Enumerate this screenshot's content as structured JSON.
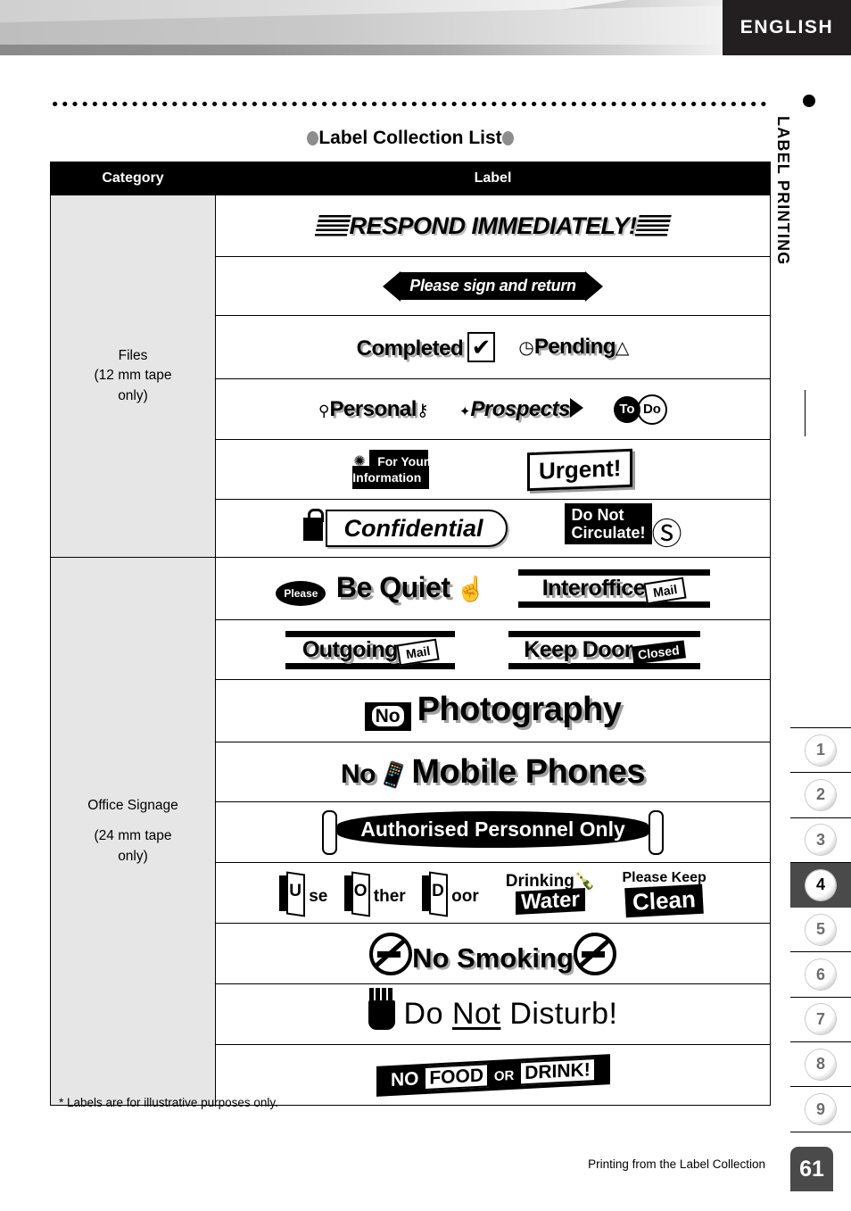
{
  "header": {
    "language_badge": "ENGLISH"
  },
  "side_tab": {
    "bullet": "bullet-dot",
    "title": "LABEL PRINTING"
  },
  "page_title": "Label Collection List",
  "table": {
    "columns": [
      "Category",
      "Label"
    ],
    "groups": [
      {
        "category": "Files\n(12 mm tape\nonly)",
        "category_name": "Files",
        "category_note": "(12 mm tape only)",
        "rows": [
          {
            "labels": [
              "RESPOND IMMEDIATELY!"
            ]
          },
          {
            "labels": [
              "Please sign and return"
            ]
          },
          {
            "labels": [
              "Completed",
              "Pending"
            ]
          },
          {
            "labels": [
              "Personal",
              "Prospects",
              "To Do"
            ]
          },
          {
            "labels": [
              "For Your Information",
              "Urgent!"
            ]
          },
          {
            "labels": [
              "Confidential",
              "Do Not Circulate!"
            ]
          }
        ]
      },
      {
        "category": "Office Signage\n(24 mm tape\nonly)",
        "category_name": "Office Signage",
        "category_note": "(24 mm tape only)",
        "rows": [
          {
            "labels": [
              "Please Be Quiet",
              "Interoffice Mail"
            ]
          },
          {
            "labels": [
              "Outgoing Mail",
              "Keep Door Closed"
            ]
          },
          {
            "labels": [
              "No Photography"
            ]
          },
          {
            "labels": [
              "No Mobile Phones"
            ]
          },
          {
            "labels": [
              "Authorised Personnel Only"
            ]
          },
          {
            "labels": [
              "Use Other Door",
              "Drinking Water",
              "Please Keep Clean"
            ]
          },
          {
            "labels": [
              "No Smoking"
            ]
          },
          {
            "labels": [
              "Do Not Disturb!"
            ]
          },
          {
            "labels": [
              "NO FOOD OR DRINK!"
            ]
          }
        ]
      }
    ]
  },
  "labels": {
    "respond": "RESPOND IMMEDIATELY!",
    "please_sign": "Please sign and return",
    "completed": "Completed",
    "pending": "Pending",
    "personal": "Personal",
    "prospects": "Prospects",
    "todo_to": "To",
    "todo_do": "Do",
    "fyi_line1": "For Your",
    "fyi_line2": "Information",
    "urgent": "Urgent!",
    "confidential": "Confidential",
    "donot_line1": "Do Not",
    "donot_line2": "Circulate!",
    "please": "Please",
    "be_quiet": "Be Quiet",
    "interoffice": "Interoffice",
    "mail": "Mail",
    "outgoing": "Outgoing",
    "outgoing_mail": "Mail",
    "keep_door": "Keep Door",
    "closed": "Closed",
    "no_small": "No",
    "photography": "Photography",
    "mobile_phones": "Mobile Phones",
    "authorised": "Authorised Personnel Only",
    "use_u": "U",
    "use_rest": "se",
    "other_o": "O",
    "other_rest": "ther",
    "door_d": "D",
    "door_rest": "oor",
    "drinking": "Drinking",
    "water": "Water",
    "please_keep": "Please Keep",
    "clean": "Clean",
    "no_smoking": "No Smoking",
    "do": "Do",
    "not": "Not",
    "disturb": "Disturb!",
    "nofood_no": "NO",
    "nofood_food": "FOOD",
    "nofood_or": "OR",
    "nofood_drink": "DRINK!"
  },
  "footnote": "* Labels are for illustrative purposes only.",
  "footer": {
    "section_title": "Printing from the Label Collection",
    "page_number": "61"
  },
  "side_tabs": [
    {
      "number": "1",
      "active": false
    },
    {
      "number": "2",
      "active": false
    },
    {
      "number": "3",
      "active": false
    },
    {
      "number": "4",
      "active": true
    },
    {
      "number": "5",
      "active": false
    },
    {
      "number": "6",
      "active": false
    },
    {
      "number": "7",
      "active": false
    },
    {
      "number": "8",
      "active": false
    },
    {
      "number": "9",
      "active": false
    }
  ],
  "colors": {
    "badge_bg": "#231f20",
    "header_gray": "#8c8c8c",
    "category_bg": "#e6e6e6",
    "active_tab_bg": "#4a4a4a",
    "title_bullet": "#8d8d8d"
  }
}
